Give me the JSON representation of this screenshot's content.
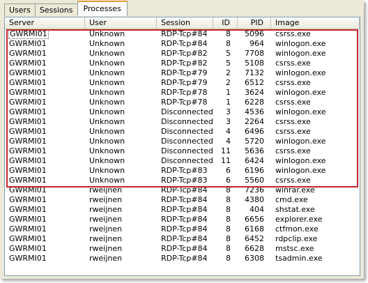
{
  "tabs": [
    {
      "label": "Users"
    },
    {
      "label": "Sessions"
    },
    {
      "label": "Processes"
    }
  ],
  "active_tab": "Processes",
  "highlight_color": "#c0272d",
  "columns": {
    "server": "Server",
    "user": "User",
    "session": "Session",
    "id": "ID",
    "pid": "PID",
    "image": "Image"
  },
  "rows": [
    {
      "server": "GWRMI01",
      "user": "Unknown",
      "session": "RDP-Tcp#84",
      "id": "8",
      "pid": "5096",
      "image": "csrss.exe"
    },
    {
      "server": "GWRMI01",
      "user": "Unknown",
      "session": "RDP-Tcp#84",
      "id": "8",
      "pid": "964",
      "image": "winlogon.exe"
    },
    {
      "server": "GWRMI01",
      "user": "Unknown",
      "session": "RDP-Tcp#82",
      "id": "5",
      "pid": "7708",
      "image": "winlogon.exe"
    },
    {
      "server": "GWRMI01",
      "user": "Unknown",
      "session": "RDP-Tcp#82",
      "id": "5",
      "pid": "5108",
      "image": "csrss.exe"
    },
    {
      "server": "GWRMI01",
      "user": "Unknown",
      "session": "RDP-Tcp#79",
      "id": "2",
      "pid": "7132",
      "image": "winlogon.exe"
    },
    {
      "server": "GWRMI01",
      "user": "Unknown",
      "session": "RDP-Tcp#79",
      "id": "2",
      "pid": "6512",
      "image": "csrss.exe"
    },
    {
      "server": "GWRMI01",
      "user": "Unknown",
      "session": "RDP-Tcp#78",
      "id": "1",
      "pid": "3624",
      "image": "winlogon.exe"
    },
    {
      "server": "GWRMI01",
      "user": "Unknown",
      "session": "RDP-Tcp#78",
      "id": "1",
      "pid": "6228",
      "image": "csrss.exe"
    },
    {
      "server": "GWRMI01",
      "user": "Unknown",
      "session": "Disconnected",
      "id": "3",
      "pid": "4536",
      "image": "winlogon.exe"
    },
    {
      "server": "GWRMI01",
      "user": "Unknown",
      "session": "Disconnected",
      "id": "3",
      "pid": "2264",
      "image": "csrss.exe"
    },
    {
      "server": "GWRMI01",
      "user": "Unknown",
      "session": "Disconnected",
      "id": "4",
      "pid": "6496",
      "image": "csrss.exe"
    },
    {
      "server": "GWRMI01",
      "user": "Unknown",
      "session": "Disconnected",
      "id": "4",
      "pid": "5720",
      "image": "winlogon.exe"
    },
    {
      "server": "GWRMI01",
      "user": "Unknown",
      "session": "Disconnected",
      "id": "11",
      "pid": "5636",
      "image": "csrss.exe"
    },
    {
      "server": "GWRMI01",
      "user": "Unknown",
      "session": "Disconnected",
      "id": "11",
      "pid": "6424",
      "image": "winlogon.exe"
    },
    {
      "server": "GWRMI01",
      "user": "Unknown",
      "session": "RDP-Tcp#83",
      "id": "6",
      "pid": "6196",
      "image": "winlogon.exe"
    },
    {
      "server": "GWRMI01",
      "user": "Unknown",
      "session": "RDP-Tcp#83",
      "id": "6",
      "pid": "5560",
      "image": "csrss.exe"
    },
    {
      "server": "GWRMI01",
      "user": "rweijnen",
      "session": "RDP-Tcp#84",
      "id": "8",
      "pid": "7236",
      "image": "winrar.exe"
    },
    {
      "server": "GWRMI01",
      "user": "rweijnen",
      "session": "RDP-Tcp#84",
      "id": "8",
      "pid": "4380",
      "image": "cmd.exe"
    },
    {
      "server": "GWRMI01",
      "user": "rweijnen",
      "session": "RDP-Tcp#84",
      "id": "8",
      "pid": "404",
      "image": "shstat.exe"
    },
    {
      "server": "GWRMI01",
      "user": "rweijnen",
      "session": "RDP-Tcp#84",
      "id": "8",
      "pid": "6656",
      "image": "explorer.exe"
    },
    {
      "server": "GWRMI01",
      "user": "rweijnen",
      "session": "RDP-Tcp#84",
      "id": "8",
      "pid": "6168",
      "image": "ctfmon.exe"
    },
    {
      "server": "GWRMI01",
      "user": "rweijnen",
      "session": "RDP-Tcp#84",
      "id": "8",
      "pid": "6452",
      "image": "rdpclip.exe"
    },
    {
      "server": "GWRMI01",
      "user": "rweijnen",
      "session": "RDP-Tcp#84",
      "id": "8",
      "pid": "6628",
      "image": "mstsc.exe"
    },
    {
      "server": "GWRMI01",
      "user": "rweijnen",
      "session": "RDP-Tcp#84",
      "id": "8",
      "pid": "6308",
      "image": "tsadmin.exe"
    }
  ]
}
